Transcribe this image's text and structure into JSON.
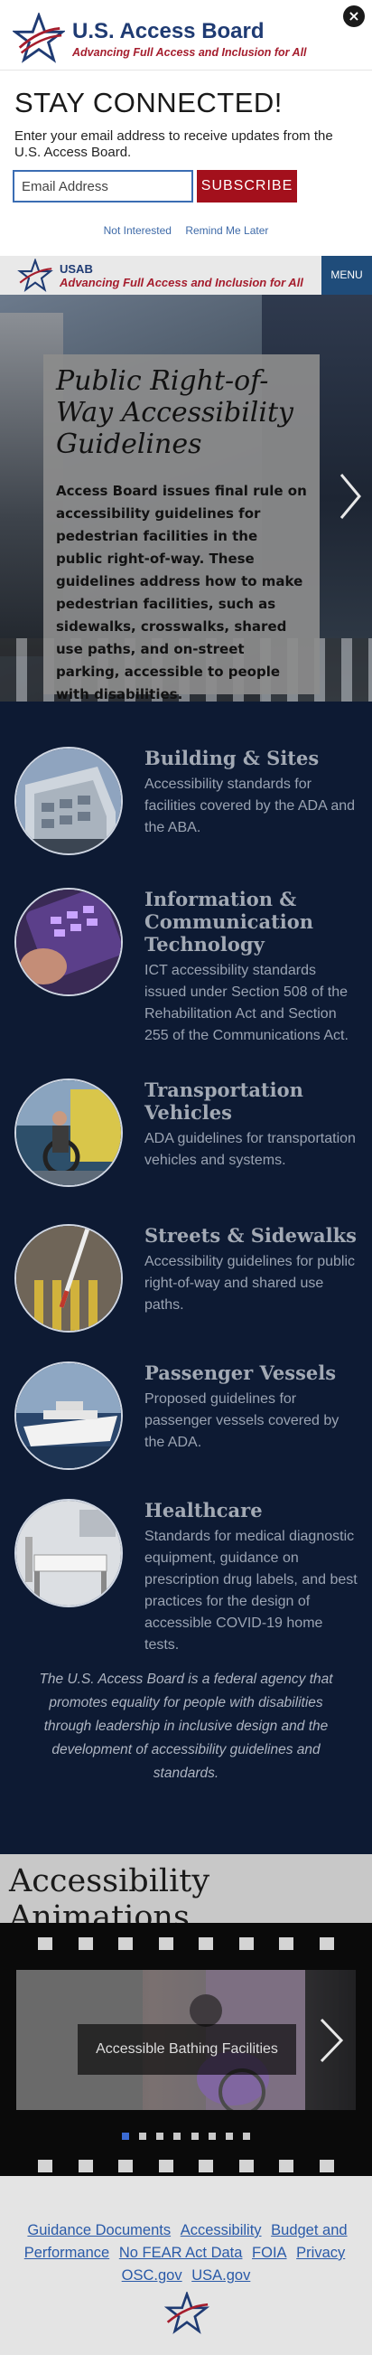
{
  "brand": {
    "title": "U.S. Access Board",
    "tagline": "Advancing Full Access and Inclusion for All",
    "colors": {
      "navy": "#1f3b73",
      "red": "#a51d2d"
    }
  },
  "signup": {
    "close_icon": "close-icon",
    "heading": "STAY CONNECTED!",
    "description": "Enter your email address to receive updates from the U.S. Access Board.",
    "email_placeholder": "Email Address",
    "subscribe_label": "SUBSCRIBE",
    "not_interested": "Not Interested",
    "remind_later": "Remind Me Later"
  },
  "navbar": {
    "short": "USAB",
    "tagline": "Advancing Full Access and Inclusion for All",
    "menu_label": "MENU"
  },
  "hero": {
    "title": "Public Right-of-Way Accessibility Guidelines",
    "body": "Access Board issues final rule on accessibility guidelines for pedestrian facilities in the public right-of-way. These guidelines address how to make pedestrian facilities, such as sidewalks, crosswalks, shared use paths, and on-street parking, accessible to people with disabilities.",
    "next_icon": "chevron-right-icon"
  },
  "categories": [
    {
      "title": "Building & Sites",
      "desc": "Accessibility standards for facilities covered by the ADA and the ABA."
    },
    {
      "title": "Information & Communication Technology",
      "desc": "ICT accessibility standards issued under Section 508 of the Rehabilitation Act and Section 255 of the Communications Act."
    },
    {
      "title": "Transportation Vehicles",
      "desc": "ADA guidelines for transportation vehicles and systems."
    },
    {
      "title": "Streets & Sidewalks",
      "desc": "Accessibility guidelines for public right-of-way and shared use paths."
    },
    {
      "title": "Passenger Vessels",
      "desc": "Proposed guidelines for passenger vessels covered by the ADA."
    },
    {
      "title": "Healthcare",
      "desc": "Standards for medical diagnostic equipment, guidance on prescription drug labels, and best practices for the design of accessible COVID-19 home tests."
    }
  ],
  "mission": "The U.S. Access Board is a federal agency that promotes equality for people with disabilities through leadership in inclusive design and the development of accessibility guidelines and standards.",
  "animations": {
    "heading": "Accessibility Animations",
    "slide_caption": "Accessible Bathing Facilities",
    "dot_count": 8,
    "active_dot": 0
  },
  "footer": {
    "links": [
      "Guidance Documents",
      "Accessibility",
      "Budget and Performance",
      "No FEAR Act Data",
      "FOIA",
      "Privacy",
      "OSC.gov",
      "USA.gov"
    ]
  }
}
